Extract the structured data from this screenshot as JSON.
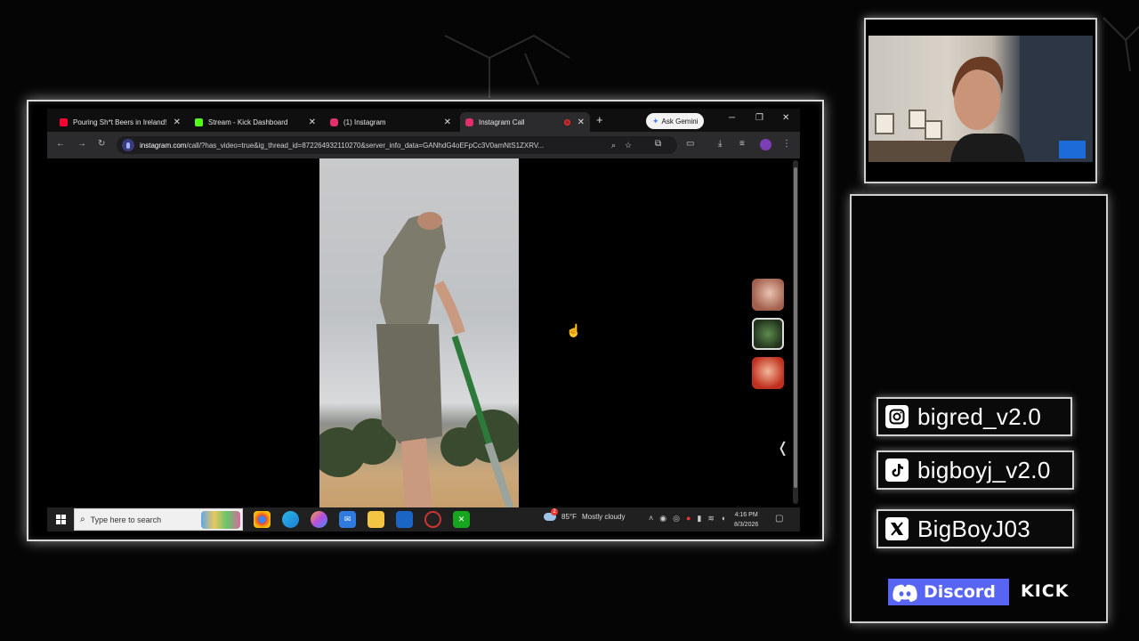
{
  "browser": {
    "tabs": [
      {
        "title": "Pouring Sh*t Beers in Ireland!",
        "color": "#ff0033",
        "active": false
      },
      {
        "title": "Stream - Kick Dashboard",
        "color": "#53fc18",
        "active": false
      },
      {
        "title": "(1) Instagram",
        "color": "#e1306c",
        "active": false
      },
      {
        "title": "Instagram Call",
        "color": "#e1306c",
        "active": true
      }
    ],
    "gemini_label": "Ask Gemini",
    "url_host": "instagram.com",
    "url_rest": "/call/?has_video=true&ig_thread_id=872264932110270&server_info_data=GANhdG4oEFpCc3V0amNtS1ZXRV..."
  },
  "taskbar": {
    "search_placeholder": "Type here to search",
    "weather_temp": "85°F",
    "weather_text": "Mostly cloudy",
    "weather_badge": "2",
    "time": "4:16 PM",
    "date": "8/3/2026"
  },
  "socials": {
    "instagram": "bigred_v2.0",
    "tiktok": "bigboyj_v2.0",
    "x": "BigBoyJ03",
    "discord": "Discord",
    "kick": "KICK"
  },
  "colors": {
    "instagram": "#e1306c",
    "kick": "#53fc18",
    "discord": "#5865f2",
    "youtube": "#ff0033"
  }
}
